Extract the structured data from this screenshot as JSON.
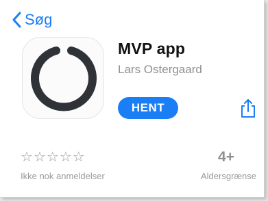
{
  "nav": {
    "back_label": "Søg",
    "back_icon": "chevron-left-icon"
  },
  "app": {
    "name": "MVP app",
    "developer": "Lars Ostergaard",
    "icon": "ring-logo-icon"
  },
  "actions": {
    "get_label": "HENT",
    "share_icon": "share-icon"
  },
  "ratings": {
    "stars_shown": 0,
    "stars_total": 5,
    "label": "Ikke nok anmeldelser"
  },
  "age": {
    "value": "4+",
    "label": "Aldersgrænse"
  },
  "colors": {
    "accent": "#1a7ef5",
    "secondary_text": "#8e8e93",
    "icon_ring": "#2f3237"
  }
}
